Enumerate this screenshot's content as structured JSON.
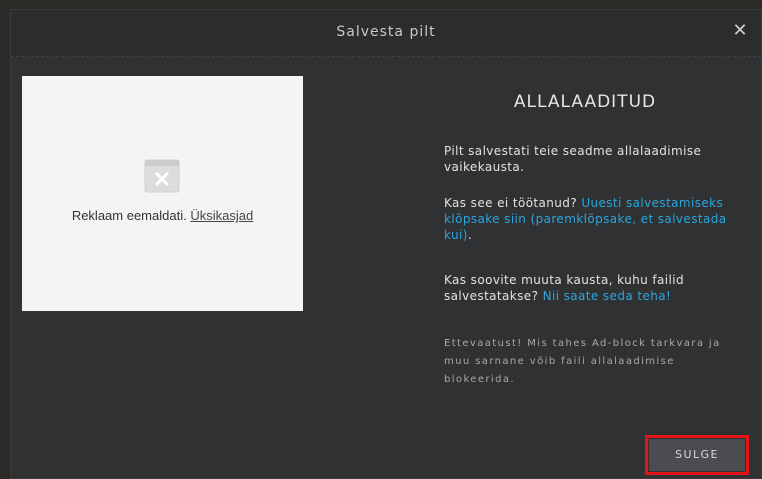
{
  "dialog": {
    "title": "Salvesta pilt",
    "close_icon": "close-icon",
    "ad": {
      "text": "Reklaam eemaldati.",
      "link": "Üksikasjad",
      "icon": "broken-ad-icon"
    },
    "heading": "ALLALAADITUD",
    "para1": "Pilt salvestati teie seadme allalaadimise vaikekausta.",
    "para2_text": "Kas see ei töötanud?",
    "para2_link": "Uuesti salvestamiseks klõpsake siin (paremklõpsake, et salvestada kui)",
    "para2_end": ".",
    "para3_text": "Kas soovite muuta kausta, kuhu failid salvestatakse?",
    "para3_link": "Nii saate seda teha!",
    "warning": "Ettevaatust! Mis tahes Ad-block tarkvara ja muu sarnane võib faili allalaadimise blokeerida.",
    "close_button": "SULGE",
    "highlight_color": "#e4141b",
    "link_color": "#2aa6dc"
  }
}
